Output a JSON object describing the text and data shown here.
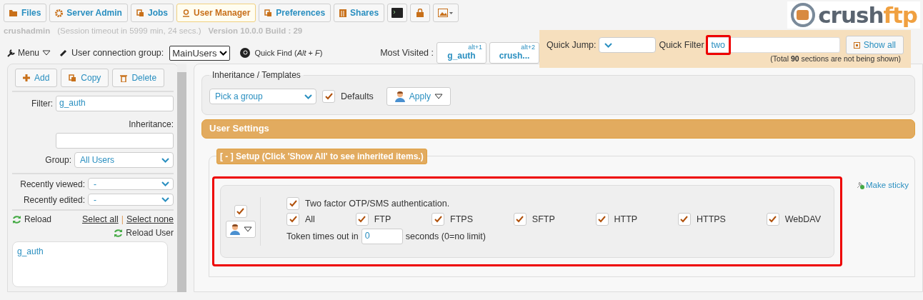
{
  "tabs": [
    {
      "label": "Files",
      "selected": false
    },
    {
      "label": "Server Admin",
      "selected": false
    },
    {
      "label": "Jobs",
      "selected": false
    },
    {
      "label": "User Manager",
      "selected": true
    },
    {
      "label": "Preferences",
      "selected": false
    },
    {
      "label": "Shares",
      "selected": false
    }
  ],
  "session": {
    "user": "crushadmin",
    "timeout": "(Session timeout in 5999 min, 24 secs.)",
    "version": "Version 10.0.0 Build : 29"
  },
  "toolbar": {
    "menu": "Menu",
    "connection_group_label": "User connection group:",
    "connection_group": "MainUsers",
    "quick_find": "Quick Find (*Alt* + *F*)",
    "most_visited_label": "Most Visited :",
    "most_visited": [
      {
        "shortcut": "alt+1",
        "label": "g_auth"
      },
      {
        "shortcut": "alt+2",
        "label": "crush..."
      }
    ]
  },
  "logo": {
    "part_1": "crush",
    "part_2": "ftp"
  },
  "quick_panel": {
    "jump_label": "Quick Jump:",
    "filter_label": "Quick Filter",
    "filter_value": "two",
    "highlighted": true,
    "show_all": "Show all",
    "note": "(Total **90** sections are not being shown)"
  },
  "left": {
    "buttons": [
      "Add",
      "Copy",
      "Delete"
    ],
    "filter_label": "Filter:",
    "filter_value": "g_auth",
    "inheritance_label": "Inheritance:",
    "group_label": "Group:",
    "group_value": "All Users",
    "recently_viewed_label": "Recently viewed:",
    "recently_viewed": "-",
    "recently_edited_label": "Recently edited:",
    "recently_edited": "-",
    "reload": "Reload",
    "select_all": "Select all",
    "separator": "|",
    "select_none": "Select none",
    "reload_user": "Reload User",
    "users": [
      {
        "name": "g_auth",
        "selected": false
      }
    ]
  },
  "main": {
    "inheritance": {
      "legend": "Inheritance / Templates",
      "pick": "Pick a group",
      "defaults_checked": true,
      "defaults": "Defaults",
      "apply": "Apply"
    },
    "user_settings": "User Settings",
    "setup": {
      "legend": "[ - ] Setup (Click 'Show All' to see inherited items.)",
      "highlighted": true,
      "make_sticky": "Make sticky",
      "item_checked": true,
      "two_factor": {
        "label": "Two factor OTP/SMS authentication.",
        "checked": true
      },
      "protocols": [
        {
          "label": "All",
          "checked": true
        },
        {
          "label": "FTP",
          "checked": true
        },
        {
          "label": "FTPS",
          "checked": true
        },
        {
          "label": "SFTP",
          "checked": true
        },
        {
          "label": "HTTP",
          "checked": true
        },
        {
          "label": "HTTPS",
          "checked": true
        },
        {
          "label": "WebDAV",
          "checked": true
        }
      ],
      "token_label": "Token times out in",
      "token_value": "0",
      "token_suffix": "seconds (0=no limit)"
    }
  }
}
